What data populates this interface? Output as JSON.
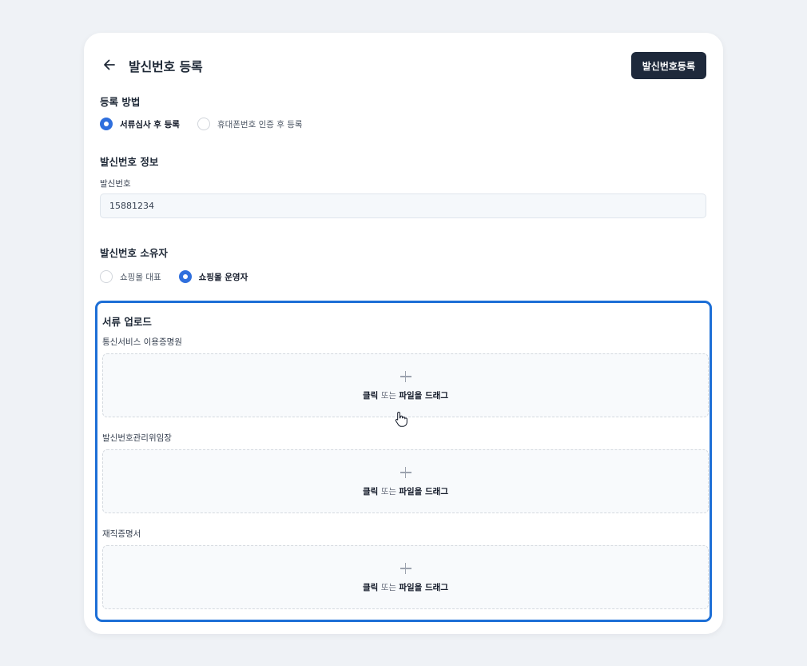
{
  "header": {
    "title": "발신번호 등록",
    "register_button": "발신번호등록"
  },
  "registration_method": {
    "title": "등록 방법",
    "options": [
      {
        "label": "서류심사 후 등록",
        "checked": true
      },
      {
        "label": "휴대폰번호 인증 후 등록",
        "checked": false
      }
    ]
  },
  "sender_info": {
    "title": "발신번호 정보",
    "field_label": "발신번호",
    "field_value": "15881234"
  },
  "owner": {
    "title": "발신번호 소유자",
    "options": [
      {
        "label": "쇼핑몰 대표",
        "checked": false
      },
      {
        "label": "쇼핑몰 운영자",
        "checked": true
      }
    ]
  },
  "documents": {
    "title": "서류 업로드",
    "items": [
      {
        "label": "통신서비스 이용증명원"
      },
      {
        "label": "발신번호관리위임장"
      },
      {
        "label": "재직증명서"
      }
    ],
    "dropzone": {
      "click": "클릭",
      "or": "또는",
      "drag": "파일을 드래그"
    }
  },
  "colors": {
    "accent": "#2f6fdd",
    "highlight_border": "#1d6fd6",
    "primary_button": "#1e293b",
    "background": "#eff2f6"
  },
  "icons": {
    "back": "arrow-left-icon",
    "add": "plus-icon",
    "cursor": "hand-pointer-icon"
  }
}
